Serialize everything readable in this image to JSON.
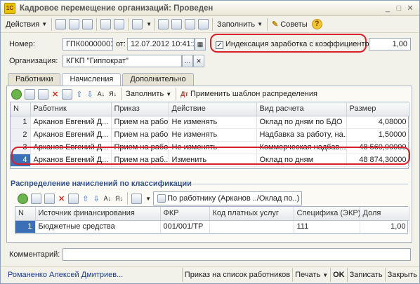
{
  "window": {
    "title": "Кадровое перемещение организаций: Проведен",
    "controls": [
      "minimize",
      "maximize",
      "close"
    ]
  },
  "toolbar": {
    "actions_label": "Действия",
    "fill_label": "Заполнить",
    "tips_label": "Советы",
    "help_label": "?"
  },
  "form": {
    "number_label": "Номер:",
    "number_value": "ГПК00000001",
    "from_label": "от:",
    "date_value": "12.07.2012 10:41:20",
    "indexation_label": "Индексация заработка с коэффициентом:",
    "indexation_checked": true,
    "coefficient_value": "1,00",
    "org_label": "Организация:",
    "org_value": "КГКП \"Гиппократ\""
  },
  "tabs": [
    {
      "label": "Работники",
      "active": false
    },
    {
      "label": "Начисления",
      "active": true
    },
    {
      "label": "Дополнительно",
      "active": false
    }
  ],
  "accruals_toolbar": {
    "fill_label": "Заполнить",
    "apply_template_label": "Применить шаблон распределения"
  },
  "accruals_table": {
    "columns": [
      "N",
      "Работник",
      "Приказ",
      "Действие",
      "Вид расчета",
      "Размер"
    ],
    "rows": [
      {
        "n": "1",
        "worker": "Арканов Евгений Д...",
        "order": "Прием на рабо...",
        "action": "Не изменять",
        "calc": "Оклад по дням по БДО",
        "size": "4,08000"
      },
      {
        "n": "2",
        "worker": "Арканов Евгений Д...",
        "order": "Прием на рабо...",
        "action": "Не изменять",
        "calc": "Надбавка за работу, на...",
        "size": "1,50000"
      },
      {
        "n": "3",
        "worker": "Арканов Евгений Д...",
        "order": "Прием на рабо...",
        "action": "Не изменять",
        "calc": "Коммерческая надбав...",
        "size": "48 560,00000"
      },
      {
        "n": "4",
        "worker": "Арканов Евгений Д...",
        "order": "Прием на раб...",
        "action": "Изменить",
        "calc": "Оклад по дням",
        "size": "48 874,30000"
      }
    ]
  },
  "distribution": {
    "title": "Распределение начислений по классификации",
    "by_worker_label": "По работнику (Арканов ../Оклад по..)",
    "columns": [
      "N",
      "Источник финансирования",
      "ФКР",
      "Код платных услуг",
      "Специфика (ЭКР)",
      "Доля"
    ],
    "rows": [
      {
        "n": "1",
        "source": "Бюджетные средства",
        "fkr": "001/001/ТР",
        "code": "",
        "spec": "111",
        "share": "1,00"
      }
    ]
  },
  "comment_label": "Комментарий:",
  "footer": {
    "user": "Романенко Алексей Дмитриев...",
    "order_list_label": "Приказ на список работников",
    "print_label": "Печать",
    "ok_label": "OK",
    "save_label": "Записать",
    "close_label": "Закрыть"
  },
  "colors": {
    "highlight": "#d8202b",
    "link": "#1a3c8f",
    "selected_row": "#3b6fb6"
  }
}
